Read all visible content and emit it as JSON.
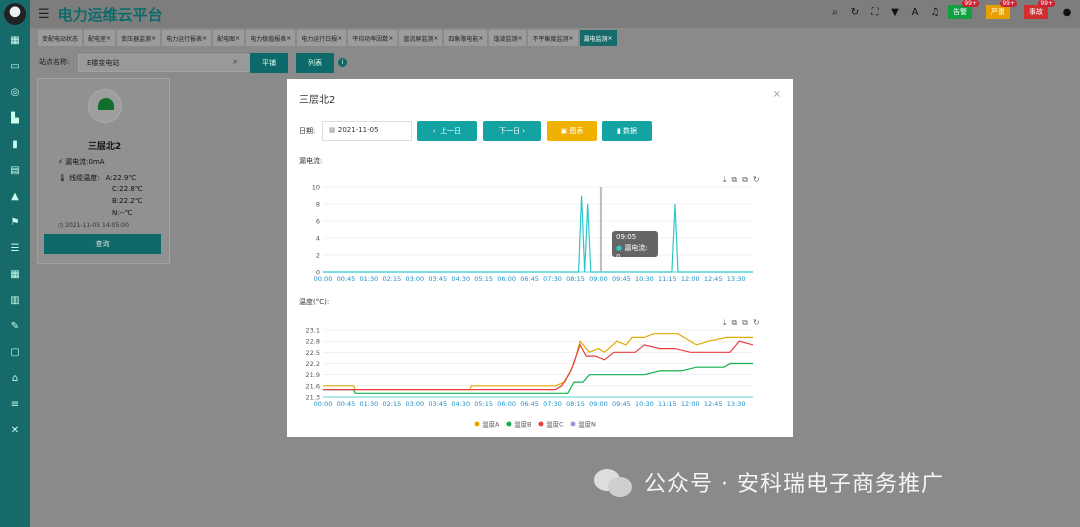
{
  "app": {
    "title": "电力运维云平台"
  },
  "header": {
    "badges": [
      {
        "label": "告警",
        "count": "99+",
        "color": "#10a040"
      },
      {
        "label": "严重",
        "count": "99+",
        "color": "#e8a000"
      },
      {
        "label": "事故",
        "count": "99+",
        "color": "#d03030"
      }
    ]
  },
  "tabs": [
    "变配电站状态",
    "配电室",
    "变压器监测",
    "电力运行报表",
    "配电图",
    "电力极值报表",
    "电力运行日报",
    "平均功率因数",
    "直流屏监测",
    "四象限电能",
    "谐波监测",
    "不平衡度监测",
    "漏电监测"
  ],
  "search": {
    "label": "站点名称:",
    "value": "E楼变电站",
    "btn_tile": "平铺",
    "btn_list": "列表"
  },
  "card": {
    "name": "三层北2",
    "leak_label": "漏电流:",
    "leak_value": "0mA",
    "temp_label": "线缆温度:",
    "temp_a": "A:22.9℃",
    "temp_c": "C:22.8℃",
    "temp_b": "B:22.2℃",
    "temp_n": "N:--℃",
    "time": "2021-11-05 14:05:00",
    "query": "查询"
  },
  "modal": {
    "title": "三层北2",
    "date_label": "日期:",
    "date_value": "2021-11-05",
    "prev": "上一日",
    "next": "下一日",
    "chart_btn": "图表",
    "data_btn": "数据",
    "leak_title": "漏电流:",
    "temp_title": "温度(°C):",
    "tooltip_time": "09:05",
    "tooltip_text": "漏电流: 0"
  },
  "watermark": "公众号 · 安科瑞电子商务推广",
  "chart_data": [
    {
      "type": "line",
      "title": "漏电流:",
      "x": [
        "00:00",
        "00:45",
        "01:30",
        "02:15",
        "03:00",
        "03:45",
        "04:30",
        "05:15",
        "06:00",
        "06:45",
        "07:30",
        "08:15",
        "09:00",
        "09:45",
        "10:30",
        "11:15",
        "12:00",
        "12:45",
        "13:30"
      ],
      "ylim": [
        0,
        10
      ],
      "yticks": [
        0,
        2,
        4,
        6,
        8,
        10
      ],
      "series": [
        {
          "name": "漏电流",
          "color": "#2ec7c9",
          "points": [
            [
              0,
              0
            ],
            [
              8.35,
              0
            ],
            [
              8.45,
              9
            ],
            [
              8.55,
              0
            ],
            [
              8.65,
              8
            ],
            [
              8.75,
              0
            ],
            [
              11.4,
              0
            ],
            [
              11.5,
              8
            ],
            [
              11.6,
              0
            ],
            [
              14.05,
              0
            ]
          ]
        }
      ]
    },
    {
      "type": "line",
      "title": "温度(°C):",
      "x": [
        "00:00",
        "00:45",
        "01:30",
        "02:15",
        "03:00",
        "03:45",
        "04:30",
        "05:15",
        "06:00",
        "06:45",
        "07:30",
        "08:15",
        "09:00",
        "09:45",
        "10:30",
        "11:15",
        "12:00",
        "12:45",
        "13:30"
      ],
      "ylim": [
        21.3,
        23.1
      ],
      "yticks": [
        21.3,
        21.6,
        21.9,
        22.2,
        22.5,
        22.8,
        23.1
      ],
      "legend": [
        "温度A",
        "温度B",
        "温度C",
        "温度N"
      ],
      "series": [
        {
          "name": "温度A",
          "color": "#e5a800",
          "points": [
            [
              0,
              21.6
            ],
            [
              1,
              21.6
            ],
            [
              1.05,
              21.5
            ],
            [
              4.8,
              21.5
            ],
            [
              4.85,
              21.6
            ],
            [
              7.6,
              21.6
            ],
            [
              7.9,
              21.7
            ],
            [
              8.2,
              22.2
            ],
            [
              8.4,
              22.8
            ],
            [
              8.7,
              22.5
            ],
            [
              9,
              22.6
            ],
            [
              9.2,
              22.5
            ],
            [
              9.6,
              22.8
            ],
            [
              9.9,
              22.7
            ],
            [
              10.1,
              22.9
            ],
            [
              10.5,
              22.9
            ],
            [
              10.8,
              23.0
            ],
            [
              11.6,
              23.0
            ],
            [
              12.2,
              22.7
            ],
            [
              12.6,
              22.8
            ],
            [
              13.2,
              22.9
            ],
            [
              14.05,
              22.9
            ]
          ]
        },
        {
          "name": "温度B",
          "color": "#10b050",
          "points": [
            [
              0,
              21.5
            ],
            [
              1,
              21.5
            ],
            [
              1.05,
              21.4
            ],
            [
              8.0,
              21.4
            ],
            [
              8.2,
              21.7
            ],
            [
              8.5,
              21.7
            ],
            [
              8.7,
              21.9
            ],
            [
              10.5,
              21.9
            ],
            [
              11.0,
              22.0
            ],
            [
              11.7,
              22.0
            ],
            [
              12.2,
              22.1
            ],
            [
              13.1,
              22.1
            ],
            [
              13.3,
              22.2
            ],
            [
              14.05,
              22.2
            ]
          ]
        },
        {
          "name": "温度C",
          "color": "#e84040",
          "points": [
            [
              0,
              21.5
            ],
            [
              7.6,
              21.5
            ],
            [
              7.8,
              21.6
            ],
            [
              8.1,
              22.0
            ],
            [
              8.4,
              22.7
            ],
            [
              8.6,
              22.4
            ],
            [
              8.9,
              22.4
            ],
            [
              9.2,
              22.3
            ],
            [
              9.5,
              22.5
            ],
            [
              10.2,
              22.5
            ],
            [
              10.5,
              22.7
            ],
            [
              11.0,
              22.6
            ],
            [
              11.5,
              22.6
            ],
            [
              12.0,
              22.5
            ],
            [
              13.3,
              22.5
            ],
            [
              13.6,
              22.8
            ],
            [
              14.05,
              22.7
            ]
          ]
        },
        {
          "name": "温度N",
          "color": "#9a9ae0",
          "points": []
        }
      ]
    }
  ]
}
